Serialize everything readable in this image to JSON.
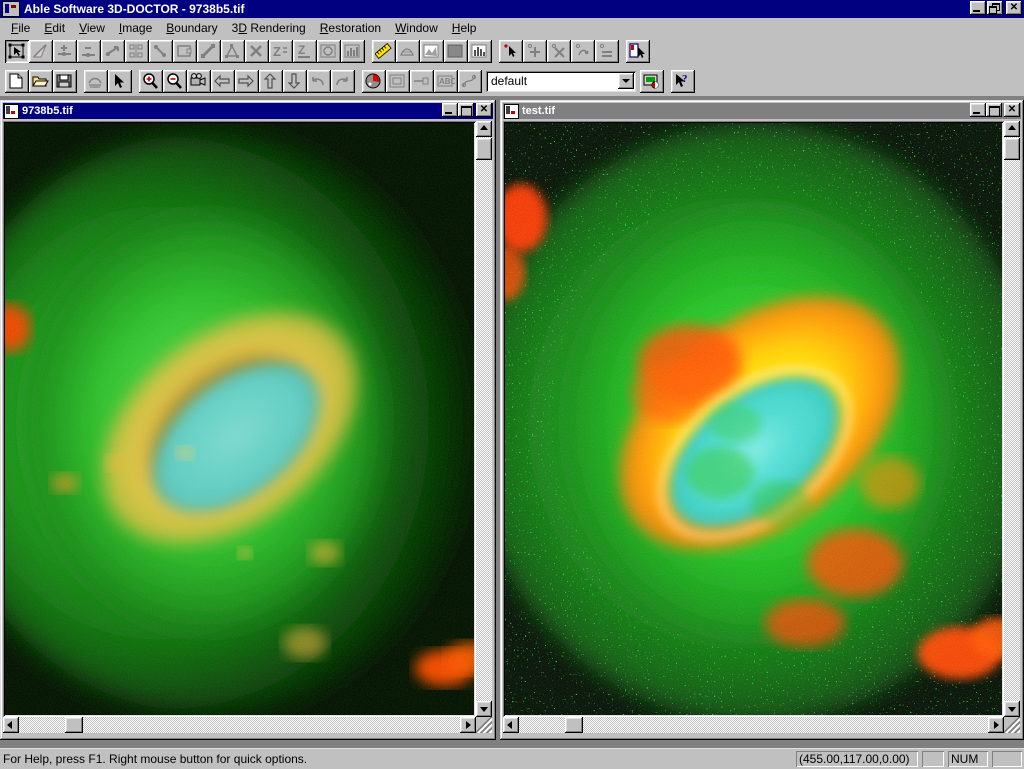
{
  "app": {
    "title": "Able Software 3D-DOCTOR - 9738b5.tif",
    "icon": "app-icon",
    "window_buttons": {
      "minimize": "_",
      "restore": "❐",
      "close": "✕"
    }
  },
  "menu": {
    "items": [
      {
        "label": "File",
        "accel": "F"
      },
      {
        "label": "Edit",
        "accel": "E"
      },
      {
        "label": "View",
        "accel": "V"
      },
      {
        "label": "Image",
        "accel": "I"
      },
      {
        "label": "Boundary",
        "accel": "B"
      },
      {
        "label": "3D Rendering",
        "accel": "D"
      },
      {
        "label": "Restoration",
        "accel": "R"
      },
      {
        "label": "Window",
        "accel": "W"
      },
      {
        "label": "Help",
        "accel": "H"
      }
    ]
  },
  "toolbar_top": {
    "buttons": [
      {
        "name": "select-object-tool",
        "icon": "select-rect-icon",
        "pressed": true
      },
      {
        "name": "draw-boundary-tool",
        "icon": "pencil-line-icon",
        "pressed": false
      },
      {
        "name": "add-point-tool",
        "icon": "add-point-icon",
        "pressed": false
      },
      {
        "name": "delete-point-tool",
        "icon": "delete-point-icon",
        "pressed": false
      },
      {
        "name": "move-point-tool",
        "icon": "move-point-icon",
        "pressed": false
      },
      {
        "name": "split-boundary-tool",
        "icon": "split-icon",
        "pressed": false
      },
      {
        "name": "merge-boundary-tool",
        "icon": "merge-icon",
        "pressed": false
      },
      {
        "name": "rectangle-boundary-tool",
        "icon": "rectangle-icon",
        "pressed": false
      },
      {
        "name": "line-boundary-tool",
        "icon": "diagonal-line-icon",
        "pressed": false
      },
      {
        "name": "polygon-boundary-tool",
        "icon": "polygon-icon",
        "pressed": false
      },
      {
        "name": "delete-boundary-tool",
        "icon": "x-delete-icon",
        "pressed": false
      },
      {
        "name": "z-order-up-tool",
        "icon": "z-up-icon",
        "pressed": false
      },
      {
        "name": "z-order-down-tool",
        "icon": "z-down-icon",
        "pressed": false
      },
      {
        "name": "boundary-frame-tool",
        "icon": "framed-boundary-icon",
        "pressed": false
      },
      {
        "name": "histogram-tool",
        "icon": "histogram-icon",
        "pressed": false
      }
    ],
    "buttons2": [
      {
        "name": "measure-tool",
        "icon": "ruler-icon",
        "pressed": false
      },
      {
        "name": "surface-render-tool",
        "icon": "surface-render-icon",
        "pressed": false
      },
      {
        "name": "volume-render-tool",
        "icon": "volume-render-icon",
        "pressed": false
      },
      {
        "name": "shade-render-tool",
        "icon": "shade-icon",
        "pressed": false
      },
      {
        "name": "plot-tool",
        "icon": "bar-plot-icon",
        "pressed": false
      }
    ],
    "buttons3": [
      {
        "name": "pick-point-tool",
        "icon": "pointer-point-icon",
        "pressed": false
      },
      {
        "name": "add-marker-tool",
        "icon": "marker-plus-icon",
        "pressed": false
      },
      {
        "name": "remove-marker-tool",
        "icon": "marker-x-icon",
        "pressed": false
      },
      {
        "name": "edit-marker-tool",
        "icon": "marker-edit-icon",
        "pressed": false
      },
      {
        "name": "equal-marker-tool",
        "icon": "marker-equal-icon",
        "pressed": false
      }
    ],
    "buttons4": [
      {
        "name": "image-select-tool",
        "icon": "image-pointer-icon",
        "pressed": false
      }
    ]
  },
  "toolbar_bottom": {
    "buttons": [
      {
        "name": "new-button",
        "icon": "new-document-icon",
        "pressed": false
      },
      {
        "name": "open-button",
        "icon": "open-folder-icon",
        "pressed": false
      },
      {
        "name": "save-button",
        "icon": "floppy-disk-icon",
        "pressed": false
      }
    ],
    "buttons2": [
      {
        "name": "print-button",
        "icon": "printer-icon",
        "pressed": false
      },
      {
        "name": "arrow-select-button",
        "icon": "arrow-pointer-icon",
        "pressed": false
      }
    ],
    "buttons3": [
      {
        "name": "zoom-in-button",
        "icon": "magnifier-plus-icon",
        "pressed": false
      },
      {
        "name": "zoom-out-button",
        "icon": "magnifier-minus-icon",
        "pressed": false
      },
      {
        "name": "animate-button",
        "icon": "movie-camera-icon",
        "pressed": false
      },
      {
        "name": "prev-slice-button",
        "icon": "arrow-left-icon",
        "pressed": false
      },
      {
        "name": "next-slice-button",
        "icon": "arrow-right-icon",
        "pressed": false
      },
      {
        "name": "up-slice-button",
        "icon": "arrow-up-icon",
        "pressed": false
      },
      {
        "name": "down-slice-button",
        "icon": "arrow-down-icon",
        "pressed": false
      },
      {
        "name": "undo-button",
        "icon": "undo-arrow-icon",
        "pressed": false
      },
      {
        "name": "redo-button",
        "icon": "redo-arrow-icon",
        "pressed": false
      }
    ],
    "buttons4": [
      {
        "name": "color-palette-button",
        "icon": "color-ball-icon",
        "pressed": false
      },
      {
        "name": "crop-button",
        "icon": "crop-frame-icon",
        "pressed": false
      },
      {
        "name": "threshold-button",
        "icon": "threshold-icon",
        "pressed": false
      },
      {
        "name": "text-annotation-button",
        "icon": "abc-text-icon",
        "pressed": false
      },
      {
        "name": "vector-edit-button",
        "icon": "vector-node-icon",
        "pressed": false
      }
    ],
    "combo": {
      "name": "boundary-preset-combo",
      "value": "default",
      "options": [
        "default"
      ]
    },
    "buttons5": [
      {
        "name": "display-settings-button",
        "icon": "display-settings-icon",
        "pressed": false
      }
    ],
    "buttons6": [
      {
        "name": "context-help-button",
        "icon": "help-arrow-icon",
        "pressed": false
      }
    ]
  },
  "windows": [
    {
      "name": "child-window-9738b5",
      "title": "9738b5.tif",
      "active": true,
      "icon": "image-document-icon",
      "buttons": {
        "minimize": "_",
        "maximize": "□",
        "close": "✕"
      },
      "scroll": {
        "h_thumb_pct": 13,
        "v_thumb_pct": 5
      }
    },
    {
      "name": "child-window-test",
      "title": "test.tif",
      "active": false,
      "icon": "image-document-icon",
      "buttons": {
        "minimize": "_",
        "maximize": "□",
        "close": "✕"
      },
      "scroll": {
        "h_thumb_pct": 13,
        "v_thumb_pct": 5
      }
    }
  ],
  "statusbar": {
    "help_text": "For Help, press F1. Right mouse button for quick options.",
    "coordinates": "(455.00,117.00,0.00)",
    "pane_blank_1": "",
    "num_lock": "NUM",
    "pane_blank_2": ""
  },
  "colors": {
    "titlebar_active": "#000080",
    "titlebar_inactive": "#808080",
    "face": "#c0c0c0",
    "desktop": "#808080",
    "cell_green": "#1fb01f",
    "cell_yellow": "#e8c64a",
    "cell_cyan": "#6fd8d0",
    "cell_orange": "#ff4500"
  }
}
